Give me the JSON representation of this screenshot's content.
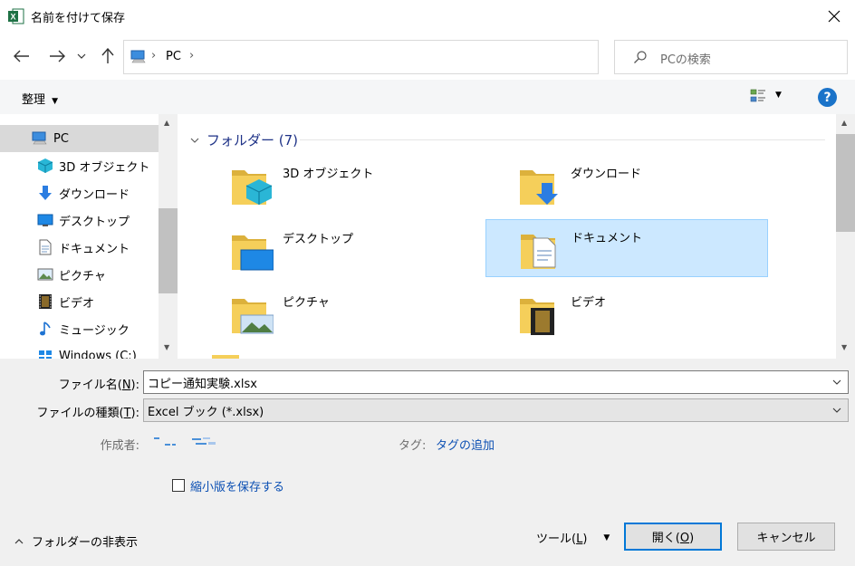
{
  "window": {
    "title": "名前を付けて保存"
  },
  "nav": {
    "back_icon": "arrow-left-icon",
    "forward_icon": "arrow-right-icon",
    "recent_icon": "chevron-down-icon",
    "up_icon": "arrow-up-icon"
  },
  "address": {
    "segments": [
      "PC"
    ],
    "sep": "›"
  },
  "search": {
    "placeholder": "PCの検索"
  },
  "commands": {
    "organize": "整理",
    "help": "?"
  },
  "navpane": {
    "items": [
      {
        "label": "PC",
        "icon": "pc-icon",
        "selected": true
      },
      {
        "label": "3D オブジェクト",
        "icon": "3d-objects-icon"
      },
      {
        "label": "ダウンロード",
        "icon": "download-icon"
      },
      {
        "label": "デスクトップ",
        "icon": "desktop-icon"
      },
      {
        "label": "ドキュメント",
        "icon": "document-icon"
      },
      {
        "label": "ピクチャ",
        "icon": "picture-icon"
      },
      {
        "label": "ビデオ",
        "icon": "video-icon"
      },
      {
        "label": "ミュージック",
        "icon": "music-icon"
      },
      {
        "label": "Windows (C:)",
        "icon": "drive-icon"
      }
    ]
  },
  "content": {
    "group_label": "フォルダー (7)",
    "folders": [
      {
        "label": "3D オブジェクト",
        "icon": "3d-objects-folder-icon"
      },
      {
        "label": "ダウンロード",
        "icon": "download-folder-icon"
      },
      {
        "label": "デスクトップ",
        "icon": "desktop-folder-icon"
      },
      {
        "label": "ドキュメント",
        "icon": "document-folder-icon",
        "selected": true
      },
      {
        "label": "ピクチャ",
        "icon": "picture-folder-icon"
      },
      {
        "label": "ビデオ",
        "icon": "video-folder-icon"
      }
    ]
  },
  "form": {
    "filename_label": "ファイル名(",
    "filename_key": "N",
    "filename_label_end": "):",
    "filename_value": "コピー通知実験.xlsx",
    "filetype_label": "ファイルの種類(",
    "filetype_key": "T",
    "filetype_label_end": "):",
    "filetype_value": "Excel ブック (*.xlsx)",
    "author_label": "作成者:",
    "tags_label": "タグ:",
    "tags_link": "タグの追加",
    "thumbnail_label": "縮小版を保存する"
  },
  "footer": {
    "hide_folders": "フォルダーの非表示",
    "tools_label": "ツール(",
    "tools_key": "L",
    "tools_end": ")",
    "open_label": "開く(",
    "open_key": "O",
    "open_end": ")",
    "cancel": "キャンセル"
  },
  "colors": {
    "accent": "#0078d7",
    "selection": "#cce8ff",
    "group_header": "#1e3287",
    "link": "#0b4fb3"
  }
}
